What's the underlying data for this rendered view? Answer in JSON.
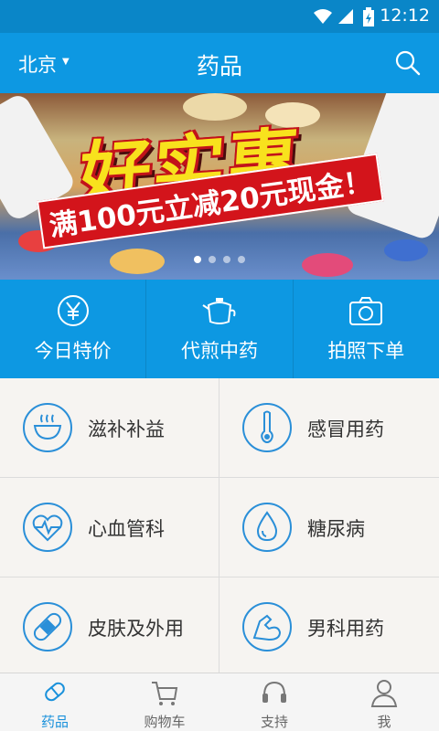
{
  "status_bar": {
    "time": "12:12"
  },
  "header": {
    "city": "北京",
    "title": "药品"
  },
  "banner": {
    "headline": "好实惠",
    "subline": "满100元立减20元现金！",
    "slides": 4,
    "active_slide": 1
  },
  "quick_actions": [
    {
      "label": "今日特价",
      "icon": "yen-icon"
    },
    {
      "label": "代煎中药",
      "icon": "herbal-pot-icon"
    },
    {
      "label": "拍照下单",
      "icon": "camera-icon"
    }
  ],
  "categories": [
    {
      "label": "滋补补益",
      "icon": "bowl-icon"
    },
    {
      "label": "感冒用药",
      "icon": "thermometer-icon"
    },
    {
      "label": "心血管科",
      "icon": "heart-pulse-icon"
    },
    {
      "label": "糖尿病",
      "icon": "drop-icon"
    },
    {
      "label": "皮肤及外用",
      "icon": "bandage-icon"
    },
    {
      "label": "男科用药",
      "icon": "muscle-icon"
    }
  ],
  "bottom_nav": [
    {
      "label": "药品",
      "icon": "capsule-icon",
      "active": true
    },
    {
      "label": "购物车",
      "icon": "cart-icon",
      "active": false
    },
    {
      "label": "支持",
      "icon": "headset-icon",
      "active": false
    },
    {
      "label": "我",
      "icon": "user-icon",
      "active": false
    }
  ],
  "colors": {
    "primary": "#0d98e2",
    "status_bar": "#0a86c8",
    "icon_blue": "#2a8fd8",
    "banner_red": "#d3141b",
    "banner_yellow": "#f8e21d"
  }
}
